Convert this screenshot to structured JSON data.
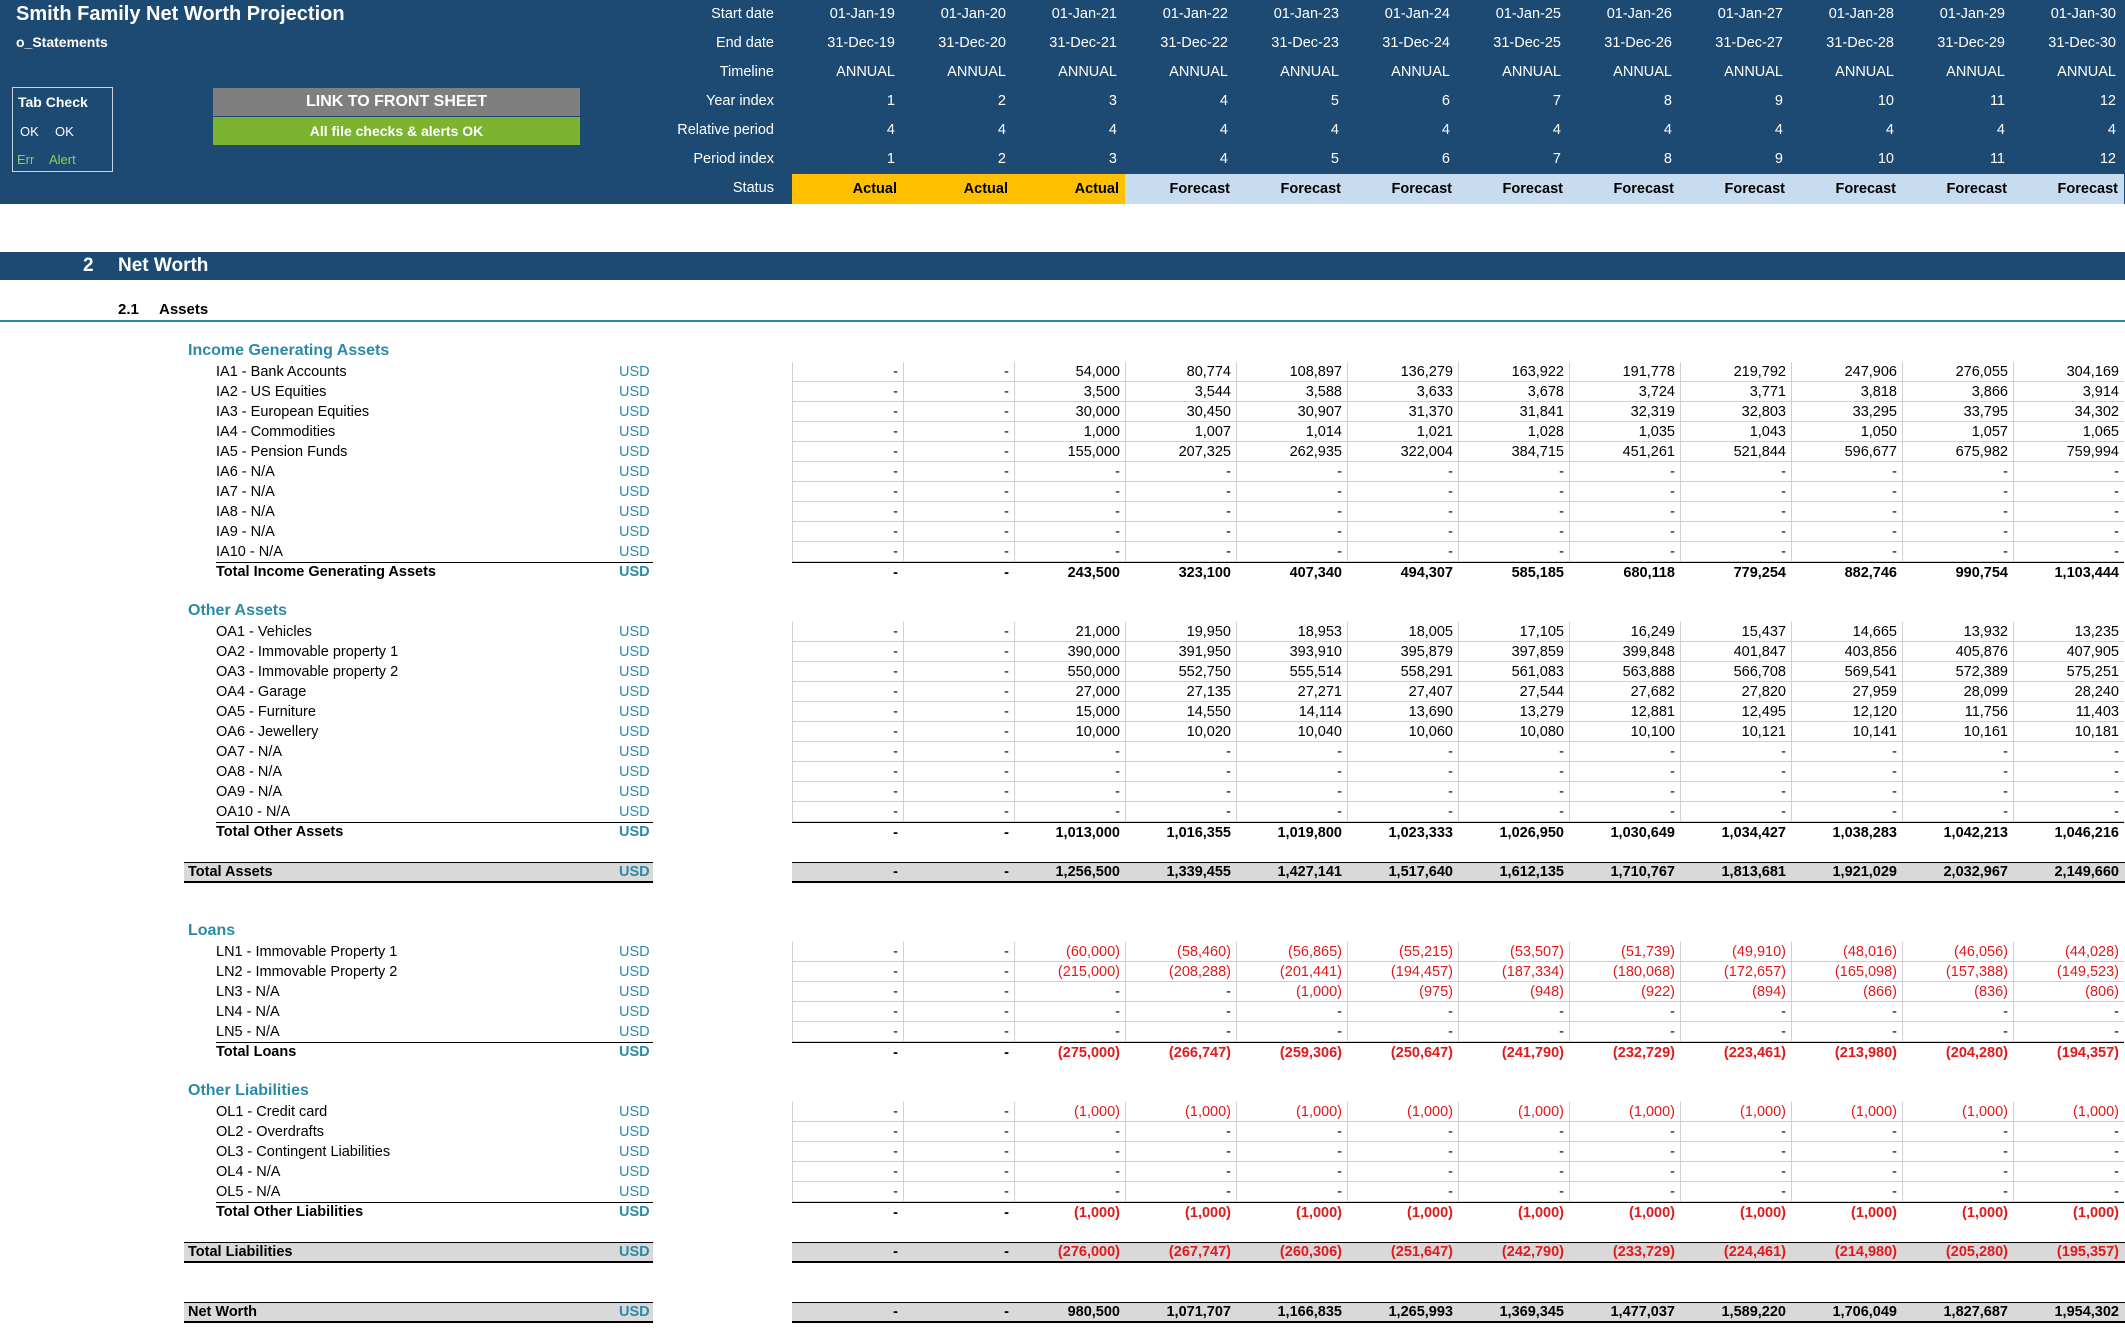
{
  "header": {
    "title": "Smith Family Net Worth Projection",
    "sheet": "o_Statements",
    "tab_check": {
      "label": "Tab Check",
      "ok1": "OK",
      "ok2": "OK",
      "err": "Err",
      "alert": "Alert"
    },
    "link_button": "LINK TO FRONT SHEET",
    "checks_button": "All file checks & alerts OK",
    "row_labels": [
      "Start date",
      "End date",
      "Timeline",
      "Year index",
      "Relative period",
      "Period index",
      "Status"
    ],
    "start_dates": [
      "01-Jan-19",
      "01-Jan-20",
      "01-Jan-21",
      "01-Jan-22",
      "01-Jan-23",
      "01-Jan-24",
      "01-Jan-25",
      "01-Jan-26",
      "01-Jan-27",
      "01-Jan-28",
      "01-Jan-29",
      "01-Jan-30"
    ],
    "end_dates": [
      "31-Dec-19",
      "31-Dec-20",
      "31-Dec-21",
      "31-Dec-22",
      "31-Dec-23",
      "31-Dec-24",
      "31-Dec-25",
      "31-Dec-26",
      "31-Dec-27",
      "31-Dec-28",
      "31-Dec-29",
      "31-Dec-30"
    ],
    "timeline": [
      "ANNUAL",
      "ANNUAL",
      "ANNUAL",
      "ANNUAL",
      "ANNUAL",
      "ANNUAL",
      "ANNUAL",
      "ANNUAL",
      "ANNUAL",
      "ANNUAL",
      "ANNUAL",
      "ANNUAL"
    ],
    "year_index": [
      "1",
      "2",
      "3",
      "4",
      "5",
      "6",
      "7",
      "8",
      "9",
      "10",
      "11",
      "12"
    ],
    "relative_period": [
      "4",
      "4",
      "4",
      "4",
      "4",
      "4",
      "4",
      "4",
      "4",
      "4",
      "4",
      "4"
    ],
    "period_index": [
      "1",
      "2",
      "3",
      "4",
      "5",
      "6",
      "7",
      "8",
      "9",
      "10",
      "11",
      "12"
    ],
    "status": [
      "Actual",
      "Actual",
      "Actual",
      "Forecast",
      "Forecast",
      "Forecast",
      "Forecast",
      "Forecast",
      "Forecast",
      "Forecast",
      "Forecast",
      "Forecast"
    ],
    "colors": {
      "header_bg": "#1c4a73",
      "actual": "#ffc000",
      "forecast": "#c7dcef",
      "ok_green": "#7cb430",
      "link_gray": "#7f7f7f"
    }
  },
  "section": {
    "number": "2",
    "name": "Net Worth"
  },
  "subsection": {
    "number": "2.1",
    "name": "Assets"
  },
  "groups": {
    "income": "Income Generating Assets",
    "other_assets": "Other Assets",
    "loans": "Loans",
    "other_liabilities": "Other Liabilities"
  },
  "rows": {
    "income": [
      {
        "label": "IA1 - Bank Accounts",
        "unit": "USD",
        "values": [
          "-",
          "-",
          "54,000",
          "80,774",
          "108,897",
          "136,279",
          "163,922",
          "191,778",
          "219,792",
          "247,906",
          "276,055",
          "304,169"
        ]
      },
      {
        "label": "IA2 - US Equities",
        "unit": "USD",
        "values": [
          "-",
          "-",
          "3,500",
          "3,544",
          "3,588",
          "3,633",
          "3,678",
          "3,724",
          "3,771",
          "3,818",
          "3,866",
          "3,914"
        ]
      },
      {
        "label": "IA3 - European Equities",
        "unit": "USD",
        "values": [
          "-",
          "-",
          "30,000",
          "30,450",
          "30,907",
          "31,370",
          "31,841",
          "32,319",
          "32,803",
          "33,295",
          "33,795",
          "34,302"
        ]
      },
      {
        "label": "IA4 - Commodities",
        "unit": "USD",
        "values": [
          "-",
          "-",
          "1,000",
          "1,007",
          "1,014",
          "1,021",
          "1,028",
          "1,035",
          "1,043",
          "1,050",
          "1,057",
          "1,065"
        ]
      },
      {
        "label": "IA5 - Pension Funds",
        "unit": "USD",
        "values": [
          "-",
          "-",
          "155,000",
          "207,325",
          "262,935",
          "322,004",
          "384,715",
          "451,261",
          "521,844",
          "596,677",
          "675,982",
          "759,994"
        ]
      },
      {
        "label": "IA6 - N/A",
        "unit": "USD",
        "values": [
          "-",
          "-",
          "-",
          "-",
          "-",
          "-",
          "-",
          "-",
          "-",
          "-",
          "-",
          "-"
        ]
      },
      {
        "label": "IA7 - N/A",
        "unit": "USD",
        "values": [
          "-",
          "-",
          "-",
          "-",
          "-",
          "-",
          "-",
          "-",
          "-",
          "-",
          "-",
          "-"
        ]
      },
      {
        "label": "IA8 - N/A",
        "unit": "USD",
        "values": [
          "-",
          "-",
          "-",
          "-",
          "-",
          "-",
          "-",
          "-",
          "-",
          "-",
          "-",
          "-"
        ]
      },
      {
        "label": "IA9 - N/A",
        "unit": "USD",
        "values": [
          "-",
          "-",
          "-",
          "-",
          "-",
          "-",
          "-",
          "-",
          "-",
          "-",
          "-",
          "-"
        ]
      },
      {
        "label": "IA10 - N/A",
        "unit": "USD",
        "values": [
          "-",
          "-",
          "-",
          "-",
          "-",
          "-",
          "-",
          "-",
          "-",
          "-",
          "-",
          "-"
        ]
      }
    ],
    "income_total": {
      "label": "Total Income Generating Assets",
      "unit": "USD",
      "values": [
        "-",
        "-",
        "243,500",
        "323,100",
        "407,340",
        "494,307",
        "585,185",
        "680,118",
        "779,254",
        "882,746",
        "990,754",
        "1,103,444"
      ]
    },
    "other_assets": [
      {
        "label": "OA1 - Vehicles",
        "unit": "USD",
        "values": [
          "-",
          "-",
          "21,000",
          "19,950",
          "18,953",
          "18,005",
          "17,105",
          "16,249",
          "15,437",
          "14,665",
          "13,932",
          "13,235"
        ]
      },
      {
        "label": "OA2 - Immovable property 1",
        "unit": "USD",
        "values": [
          "-",
          "-",
          "390,000",
          "391,950",
          "393,910",
          "395,879",
          "397,859",
          "399,848",
          "401,847",
          "403,856",
          "405,876",
          "407,905"
        ]
      },
      {
        "label": "OA3 - Immovable property 2",
        "unit": "USD",
        "values": [
          "-",
          "-",
          "550,000",
          "552,750",
          "555,514",
          "558,291",
          "561,083",
          "563,888",
          "566,708",
          "569,541",
          "572,389",
          "575,251"
        ]
      },
      {
        "label": "OA4 - Garage",
        "unit": "USD",
        "values": [
          "-",
          "-",
          "27,000",
          "27,135",
          "27,271",
          "27,407",
          "27,544",
          "27,682",
          "27,820",
          "27,959",
          "28,099",
          "28,240"
        ]
      },
      {
        "label": "OA5 - Furniture",
        "unit": "USD",
        "values": [
          "-",
          "-",
          "15,000",
          "14,550",
          "14,114",
          "13,690",
          "13,279",
          "12,881",
          "12,495",
          "12,120",
          "11,756",
          "11,403"
        ]
      },
      {
        "label": "OA6 - Jewellery",
        "unit": "USD",
        "values": [
          "-",
          "-",
          "10,000",
          "10,020",
          "10,040",
          "10,060",
          "10,080",
          "10,100",
          "10,121",
          "10,141",
          "10,161",
          "10,181"
        ]
      },
      {
        "label": "OA7 - N/A",
        "unit": "USD",
        "values": [
          "-",
          "-",
          "-",
          "-",
          "-",
          "-",
          "-",
          "-",
          "-",
          "-",
          "-",
          "-"
        ]
      },
      {
        "label": "OA8 - N/A",
        "unit": "USD",
        "values": [
          "-",
          "-",
          "-",
          "-",
          "-",
          "-",
          "-",
          "-",
          "-",
          "-",
          "-",
          "-"
        ]
      },
      {
        "label": "OA9 - N/A",
        "unit": "USD",
        "values": [
          "-",
          "-",
          "-",
          "-",
          "-",
          "-",
          "-",
          "-",
          "-",
          "-",
          "-",
          "-"
        ]
      },
      {
        "label": "OA10 - N/A",
        "unit": "USD",
        "values": [
          "-",
          "-",
          "-",
          "-",
          "-",
          "-",
          "-",
          "-",
          "-",
          "-",
          "-",
          "-"
        ]
      }
    ],
    "other_assets_total": {
      "label": "Total Other Assets",
      "unit": "USD",
      "values": [
        "-",
        "-",
        "1,013,000",
        "1,016,355",
        "1,019,800",
        "1,023,333",
        "1,026,950",
        "1,030,649",
        "1,034,427",
        "1,038,283",
        "1,042,213",
        "1,046,216"
      ]
    },
    "total_assets": {
      "label": "Total Assets",
      "unit": "USD",
      "values": [
        "-",
        "-",
        "1,256,500",
        "1,339,455",
        "1,427,141",
        "1,517,640",
        "1,612,135",
        "1,710,767",
        "1,813,681",
        "1,921,029",
        "2,032,967",
        "2,149,660"
      ]
    },
    "loans": [
      {
        "label": "LN1 - Immovable Property 1",
        "unit": "USD",
        "values": [
          "-",
          "-",
          "(60,000)",
          "(58,460)",
          "(56,865)",
          "(55,215)",
          "(53,507)",
          "(51,739)",
          "(49,910)",
          "(48,016)",
          "(46,056)",
          "(44,028)"
        ]
      },
      {
        "label": "LN2 - Immovable Property 2",
        "unit": "USD",
        "values": [
          "-",
          "-",
          "(215,000)",
          "(208,288)",
          "(201,441)",
          "(194,457)",
          "(187,334)",
          "(180,068)",
          "(172,657)",
          "(165,098)",
          "(157,388)",
          "(149,523)"
        ]
      },
      {
        "label": "LN3 - N/A",
        "unit": "USD",
        "values": [
          "-",
          "-",
          "-",
          "-",
          "(1,000)",
          "(975)",
          "(948)",
          "(922)",
          "(894)",
          "(866)",
          "(836)",
          "(806)"
        ]
      },
      {
        "label": "LN4 - N/A",
        "unit": "USD",
        "values": [
          "-",
          "-",
          "-",
          "-",
          "-",
          "-",
          "-",
          "-",
          "-",
          "-",
          "-",
          "-"
        ]
      },
      {
        "label": "LN5 - N/A",
        "unit": "USD",
        "values": [
          "-",
          "-",
          "-",
          "-",
          "-",
          "-",
          "-",
          "-",
          "-",
          "-",
          "-",
          "-"
        ]
      }
    ],
    "loans_total": {
      "label": "Total Loans",
      "unit": "USD",
      "values": [
        "-",
        "-",
        "(275,000)",
        "(266,747)",
        "(259,306)",
        "(250,647)",
        "(241,790)",
        "(232,729)",
        "(223,461)",
        "(213,980)",
        "(204,280)",
        "(194,357)"
      ]
    },
    "other_liabilities": [
      {
        "label": "OL1 - Credit card",
        "unit": "USD",
        "values": [
          "-",
          "-",
          "(1,000)",
          "(1,000)",
          "(1,000)",
          "(1,000)",
          "(1,000)",
          "(1,000)",
          "(1,000)",
          "(1,000)",
          "(1,000)",
          "(1,000)"
        ]
      },
      {
        "label": "OL2 - Overdrafts",
        "unit": "USD",
        "values": [
          "-",
          "-",
          "-",
          "-",
          "-",
          "-",
          "-",
          "-",
          "-",
          "-",
          "-",
          "-"
        ]
      },
      {
        "label": "OL3 - Contingent Liabilities",
        "unit": "USD",
        "values": [
          "-",
          "-",
          "-",
          "-",
          "-",
          "-",
          "-",
          "-",
          "-",
          "-",
          "-",
          "-"
        ]
      },
      {
        "label": "OL4 - N/A",
        "unit": "USD",
        "values": [
          "-",
          "-",
          "-",
          "-",
          "-",
          "-",
          "-",
          "-",
          "-",
          "-",
          "-",
          "-"
        ]
      },
      {
        "label": "OL5 - N/A",
        "unit": "USD",
        "values": [
          "-",
          "-",
          "-",
          "-",
          "-",
          "-",
          "-",
          "-",
          "-",
          "-",
          "-",
          "-"
        ]
      }
    ],
    "other_liabilities_total": {
      "label": "Total Other Liabilities",
      "unit": "USD",
      "values": [
        "-",
        "-",
        "(1,000)",
        "(1,000)",
        "(1,000)",
        "(1,000)",
        "(1,000)",
        "(1,000)",
        "(1,000)",
        "(1,000)",
        "(1,000)",
        "(1,000)"
      ]
    },
    "total_liabilities": {
      "label": "Total Liabilities",
      "unit": "USD",
      "values": [
        "-",
        "-",
        "(276,000)",
        "(267,747)",
        "(260,306)",
        "(251,647)",
        "(242,790)",
        "(233,729)",
        "(224,461)",
        "(214,980)",
        "(205,280)",
        "(195,357)"
      ]
    },
    "net_worth": {
      "label": "Net Worth",
      "unit": "USD",
      "values": [
        "-",
        "-",
        "980,500",
        "1,071,707",
        "1,166,835",
        "1,265,993",
        "1,369,345",
        "1,477,037",
        "1,589,220",
        "1,706,049",
        "1,827,687",
        "1,954,302"
      ]
    }
  }
}
